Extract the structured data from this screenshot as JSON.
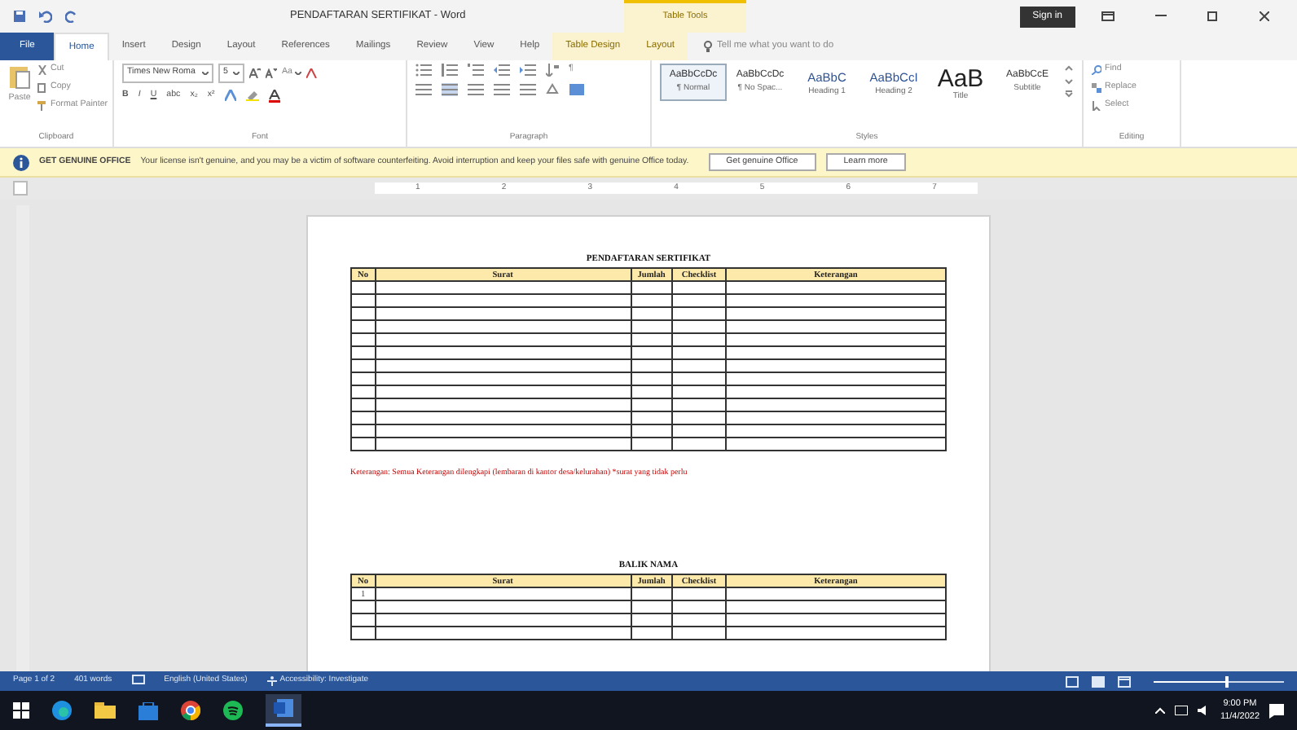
{
  "window": {
    "title": "PENDAFTARAN SERTIFIKAT  -  Word",
    "context_tab": "Table Tools",
    "sign_in": "Sign in"
  },
  "tabs": [
    {
      "label": "File",
      "kind": "file",
      "selected": false
    },
    {
      "label": "Home",
      "kind": "tab",
      "selected": true
    },
    {
      "label": "Insert",
      "kind": "tab",
      "selected": false
    },
    {
      "label": "Design",
      "kind": "tab",
      "selected": false
    },
    {
      "label": "Layout",
      "kind": "tab",
      "selected": false
    },
    {
      "label": "References",
      "kind": "tab",
      "selected": false
    },
    {
      "label": "Mailings",
      "kind": "tab",
      "selected": false
    },
    {
      "label": "Review",
      "kind": "tab",
      "selected": false
    },
    {
      "label": "View",
      "kind": "tab",
      "selected": false
    },
    {
      "label": "Help",
      "kind": "tab",
      "selected": false
    },
    {
      "label": "Table Design",
      "kind": "context",
      "selected": false
    },
    {
      "label": "Layout",
      "kind": "context",
      "selected": false
    }
  ],
  "tell_me": {
    "placeholder": "Tell me what you want to do"
  },
  "clipboard": {
    "paste": "Paste",
    "cut": "Cut",
    "copy": "Copy",
    "format_painter": "Format Painter",
    "label": "Clipboard"
  },
  "font": {
    "name": "Times New Roma",
    "size": "5",
    "case": "Aa",
    "bold": "B",
    "italic": "I",
    "underline": "U",
    "strike": "abc",
    "sub": "x₂",
    "sup": "x²",
    "label": "Font"
  },
  "paragraph": {
    "label": "Paragraph",
    "pilcrow": "¶"
  },
  "styles": {
    "label": "Styles",
    "items": [
      {
        "sample": "AaBbCcDc",
        "name": "¶ Normal",
        "kind": "body",
        "selected": true
      },
      {
        "sample": "AaBbCcDc",
        "name": "¶ No Spac...",
        "kind": "body",
        "selected": false
      },
      {
        "sample": "AaBbC",
        "name": "Heading 1",
        "kind": "heading",
        "selected": false
      },
      {
        "sample": "AaBbCcI",
        "name": "Heading 2",
        "kind": "heading",
        "selected": false
      },
      {
        "sample": "AaB",
        "name": "Title",
        "kind": "title",
        "selected": false
      },
      {
        "sample": "AaBbCcE",
        "name": "Subtitle",
        "kind": "body",
        "selected": false
      }
    ]
  },
  "editing": {
    "label": "Editing",
    "find": "Find",
    "replace": "Replace",
    "select": "Select"
  },
  "message_bar": {
    "title": "GET GENUINE OFFICE",
    "text": "Your license isn't genuine, and you may be a victim of software counterfeiting. Avoid interruption and keep your files safe with genuine Office today.",
    "buttons": [
      "Get genuine Office",
      "Learn more"
    ]
  },
  "ruler": [
    "1",
    "2",
    "3",
    "4",
    "5",
    "6",
    "7"
  ],
  "document": {
    "tables": [
      {
        "title": "PENDAFTARAN SERTIFIKAT",
        "columns": [
          "No",
          "Surat",
          "Jumlah",
          "Checklist",
          "Keterangan"
        ],
        "rows": [
          {},
          {},
          {},
          {},
          {},
          {},
          {},
          {},
          {},
          {},
          {},
          {},
          {}
        ],
        "note": "Keterangan: Semua Keterangan dilengkapi (lembaran di kantor desa/kelurahan) *surat yang tidak perlu"
      },
      {
        "title": "BALIK NAMA",
        "columns": [
          "No",
          "Surat",
          "Jumlah",
          "Checklist",
          "Keterangan"
        ],
        "rows": [
          {
            "no": "1"
          },
          {},
          {},
          {}
        ]
      }
    ]
  },
  "status_bar": {
    "page": "Page 1 of 2",
    "words": "401 words",
    "language": "English (United States)",
    "accessibility": "Accessibility: Investigate",
    "zoom": {
      "level": 0.55
    }
  },
  "taskbar": {
    "time": "9:00 PM",
    "date": "11/4/2022"
  }
}
